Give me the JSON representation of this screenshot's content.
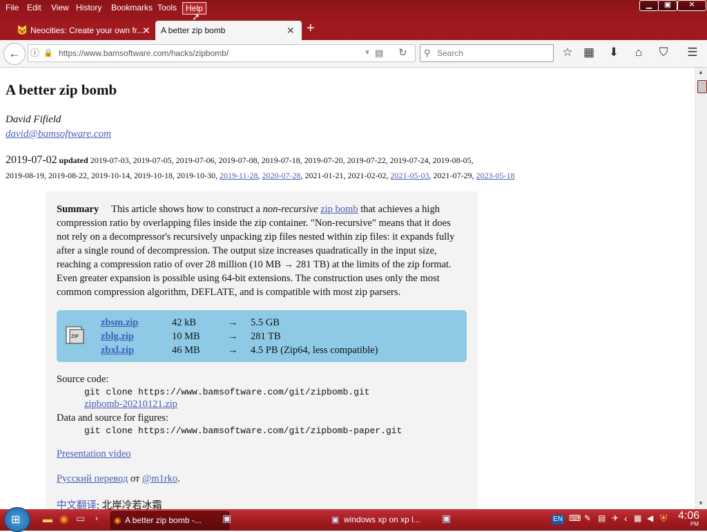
{
  "menu": [
    "File",
    "Edit",
    "View",
    "History",
    "Bookmarks",
    "Tools",
    "Help"
  ],
  "tabs": [
    {
      "label": "Neocities: Create your own fr..."
    },
    {
      "label": "A better zip bomb"
    }
  ],
  "url": "https://www.bamsoftware.com/hacks/zipbomb/",
  "search_placeholder": "Search",
  "page": {
    "title": "A better zip bomb",
    "author": "David Fifield",
    "email": "david@bamsoftware.com",
    "date": "2019-07-02",
    "updated_label": "updated",
    "updated_plain": "2019-07-03, 2019-07-05, 2019-07-06, 2019-07-08, 2019-07-18, 2019-07-20, 2019-07-22, 2019-07-24, 2019-08-05,",
    "updated_plain2": "2019-08-19, 2019-08-22, 2019-10-14, 2019-10-18, 2019-10-30,",
    "updated_links": [
      "2019-11-28",
      "2020-07-28"
    ],
    "updated_mid": "2021-01-21, 2021-02-02,",
    "updated_link3": "2021-05-03",
    "updated_mid2": "2021-07-29,",
    "updated_link4": "2023-05-18",
    "summary_label": "Summary",
    "summary_1": "This article shows how to construct a",
    "summary_em": "non-recursive",
    "summary_link": "zip bomb",
    "summary_2": "that achieves a high compression ratio by overlapping files inside the zip container. \"Non-recursive\" means that it does not rely on a decompressor's recursively unpacking zip files nested within zip files: it expands fully after a single round of decompression. The output size increases quadratically in the input size, reaching a compression ratio of over 28 million (10 MB → 281 TB) at the limits of the zip format. Even greater expansion is possible using 64-bit extensions. The construction uses only the most common compression algorithm, DEFLATE, and is compatible with most zip parsers.",
    "files": [
      {
        "name": "zbsm.zip",
        "size": "42 kB",
        "arrow": "→",
        "out": "5.5 GB"
      },
      {
        "name": "zblg.zip",
        "size": "10 MB",
        "arrow": "→",
        "out": "281 TB"
      },
      {
        "name": "zbxl.zip",
        "size": "46 MB",
        "arrow": "→",
        "out": "4.5 PB (Zip64, less compatible)"
      }
    ],
    "source_label": "Source code:",
    "source_cmd": "git clone https://www.bamsoftware.com/git/zipbomb.git",
    "source_zip": "zipbomb-20210121.zip",
    "data_label": "Data and source for figures:",
    "data_cmd": "git clone https://www.bamsoftware.com/git/zipbomb-paper.git",
    "video": "Presentation video",
    "russian": "Русский перевод",
    "russian_from": "от",
    "russian_author": "@m1rko",
    "chinese": "中文翻译",
    "chinese_author": ": 北岸冷若冰霜"
  },
  "taskbar": {
    "task1": "A better zip bomb -...",
    "task2": "windows xp on xp l...",
    "lang": "EN",
    "time": "4:06",
    "ampm": "PM"
  },
  "colors": {
    "chrome": "#a01a20",
    "box": "#8ecae6",
    "link": "#4b5db8"
  }
}
